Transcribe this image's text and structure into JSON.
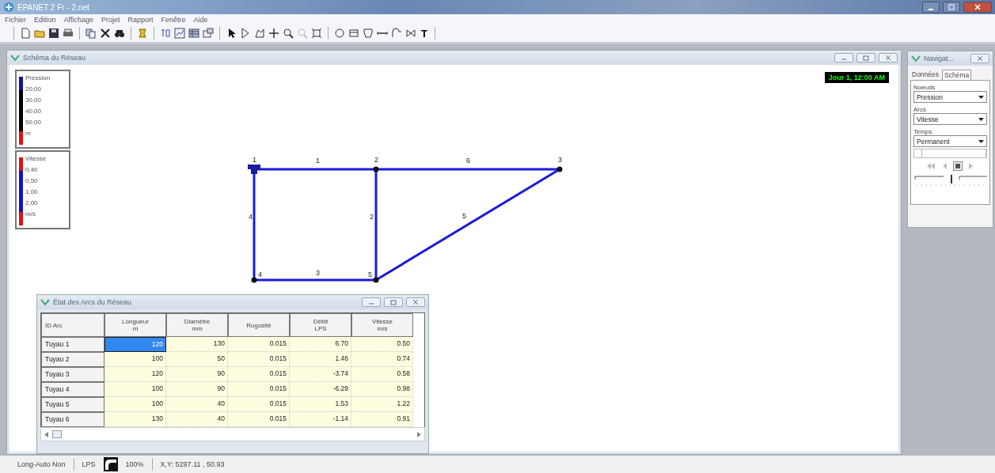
{
  "window": {
    "title": "EPANET 2 Fr - 2.net"
  },
  "menu": [
    "Fichier",
    "Edition",
    "Affichage",
    "Projet",
    "Rapport",
    "Fenêtre",
    "Aide"
  ],
  "toolbar": {
    "text_tool": "T"
  },
  "map_window": {
    "title": "Schéma du Réseau",
    "time": "Jour 1, 12:00 AM",
    "legends": [
      {
        "title": "Pression",
        "values": [
          "20,00",
          "30,00",
          "40,00",
          "50,00"
        ],
        "unit": "m",
        "segments": [
          {
            "color": "#1010a0"
          },
          {
            "color": "#000000"
          },
          {
            "color": "#000000"
          },
          {
            "color": "#000000"
          },
          {
            "color": "#e01010"
          }
        ]
      },
      {
        "title": "Vitesse",
        "values": [
          "0,40",
          "0,50",
          "1,00",
          "2,00"
        ],
        "unit": "m/s",
        "segments": [
          {
            "color": "#e01010"
          },
          {
            "color": "#1010d0"
          },
          {
            "color": "#1010d0"
          },
          {
            "color": "#1010d0"
          },
          {
            "color": "#e01010"
          }
        ]
      }
    ],
    "nodes": [
      {
        "label": "1",
        "kind": "reservoir"
      },
      {
        "label": "2",
        "kind": "junction"
      },
      {
        "label": "3",
        "kind": "junction"
      },
      {
        "label": "4",
        "kind": "junction"
      },
      {
        "label": "5",
        "kind": "junction"
      }
    ],
    "links": [
      {
        "label": "1"
      },
      {
        "label": "6"
      },
      {
        "label": "4"
      },
      {
        "label": "2"
      },
      {
        "label": "3"
      },
      {
        "label": "5"
      }
    ]
  },
  "navigator": {
    "title": "Navigat...",
    "tabs": [
      {
        "label": "Données",
        "selected": false
      },
      {
        "label": "Schéma",
        "selected": true
      }
    ],
    "fields": [
      {
        "label": "Noeuds",
        "value": "Pression"
      },
      {
        "label": "Arcs",
        "value": "Vitesse"
      },
      {
        "label": "Temps",
        "value": "Permanent"
      }
    ],
    "speed": {
      "level": 0.5
    }
  },
  "table_window": {
    "title": "État des Arcs du Réseau",
    "columns": [
      {
        "name": "ID Arc"
      },
      {
        "name": "Longueur",
        "unit": "m"
      },
      {
        "name": "Diamètre",
        "unit": "mm"
      },
      {
        "name": "Rugosité"
      },
      {
        "name": "Débit",
        "unit": "LPS"
      },
      {
        "name": "Vitesse",
        "unit": "m/s"
      }
    ],
    "rows": [
      {
        "id": "Tuyau 1",
        "cells": [
          {
            "value": "120",
            "selected": true
          },
          {
            "value": "130",
            "selected": false
          },
          {
            "value": "0.015",
            "selected": false
          },
          {
            "value": "6.70",
            "selected": false
          },
          {
            "value": "0.50",
            "selected": false
          }
        ]
      },
      {
        "id": "Tuyau 2",
        "cells": [
          {
            "value": "100",
            "selected": false
          },
          {
            "value": "50",
            "selected": false
          },
          {
            "value": "0.015",
            "selected": false
          },
          {
            "value": "1.46",
            "selected": false
          },
          {
            "value": "0.74",
            "selected": false
          }
        ]
      },
      {
        "id": "Tuyau 3",
        "cells": [
          {
            "value": "120",
            "selected": false
          },
          {
            "value": "90",
            "selected": false
          },
          {
            "value": "0.015",
            "selected": false
          },
          {
            "value": "-3.74",
            "selected": false
          },
          {
            "value": "0.58",
            "selected": false
          }
        ]
      },
      {
        "id": "Tuyau 4",
        "cells": [
          {
            "value": "100",
            "selected": false
          },
          {
            "value": "90",
            "selected": false
          },
          {
            "value": "0.015",
            "selected": false
          },
          {
            "value": "-6.29",
            "selected": false
          },
          {
            "value": "0.98",
            "selected": false
          }
        ]
      },
      {
        "id": "Tuyau 5",
        "cells": [
          {
            "value": "100",
            "selected": false
          },
          {
            "value": "40",
            "selected": false
          },
          {
            "value": "0.015",
            "selected": false
          },
          {
            "value": "1.53",
            "selected": false
          },
          {
            "value": "1.22",
            "selected": false
          }
        ]
      },
      {
        "id": "Tuyau 6",
        "cells": [
          {
            "value": "130",
            "selected": false
          },
          {
            "value": "40",
            "selected": false
          },
          {
            "value": "0.015",
            "selected": false
          },
          {
            "value": "-1.14",
            "selected": false
          },
          {
            "value": "0.91",
            "selected": false
          }
        ]
      }
    ]
  },
  "status_bar": {
    "auto_length": "Long-Auto Non",
    "units": "LPS",
    "zoom": "100%",
    "coordinates": "X,Y: 5297.11 , 50.93"
  }
}
